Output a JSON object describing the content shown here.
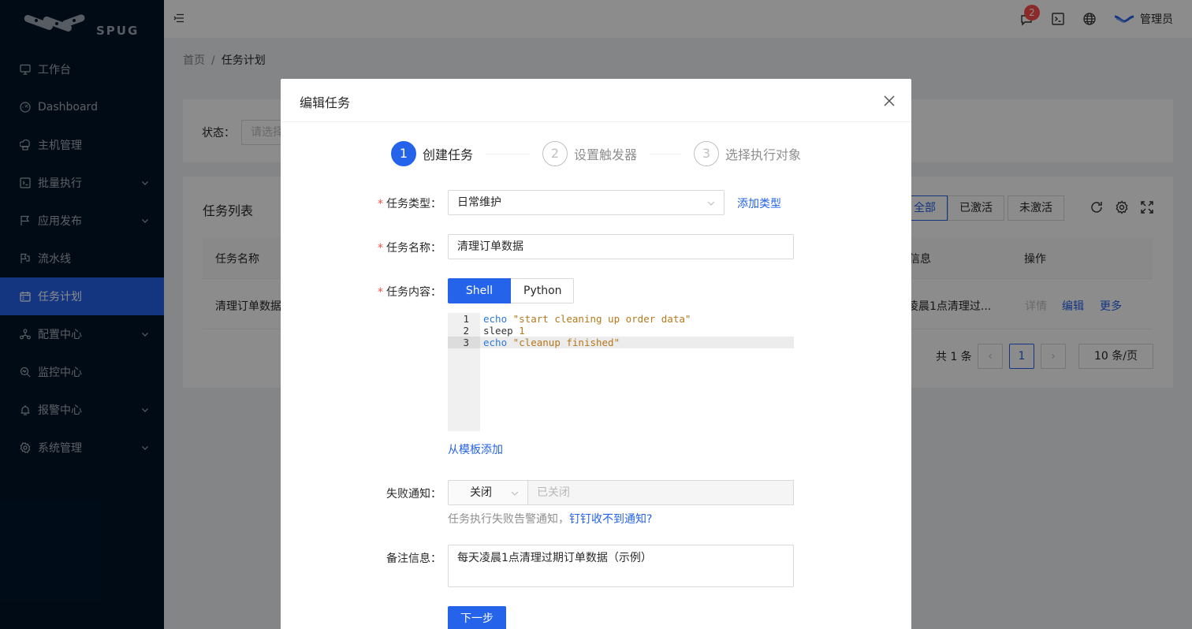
{
  "app": {
    "logo_text": "SPUG",
    "user_name": "管理员",
    "notification_count": "2",
    "accent": "#2563eb"
  },
  "sidebar": {
    "items": [
      {
        "label": "工作台",
        "icon": "desktop-icon"
      },
      {
        "label": "Dashboard",
        "icon": "dashboard-icon"
      },
      {
        "label": "主机管理",
        "icon": "cloud-server-icon"
      },
      {
        "label": "批量执行",
        "icon": "code-icon"
      },
      {
        "label": "应用发布",
        "icon": "flag-icon"
      },
      {
        "label": "流水线",
        "icon": "pipeline-icon"
      },
      {
        "label": "任务计划",
        "icon": "schedule-icon"
      },
      {
        "label": "配置中心",
        "icon": "deployment-icon"
      },
      {
        "label": "监控中心",
        "icon": "monitor-icon"
      },
      {
        "label": "报警中心",
        "icon": "alert-icon"
      },
      {
        "label": "系统管理",
        "icon": "setting-icon"
      }
    ]
  },
  "breadcrumb": {
    "home": "首页",
    "separator": "/",
    "current": "任务计划"
  },
  "filter": {
    "status_label": "状态：",
    "status_placeholder": "请选择"
  },
  "task_list": {
    "title": "任务列表",
    "tabs": [
      "全部",
      "已激活",
      "未激活"
    ],
    "columns": {
      "name": "任务名称",
      "info": "信息",
      "ops": "操作"
    },
    "row": {
      "name": "清理订单数据",
      "info": "凌晨1点清理过...",
      "detail": "详情",
      "edit": "编辑",
      "more": "更多"
    },
    "pagination": {
      "total": "共 1 条",
      "page": "1",
      "page_size": "10 条/页"
    }
  },
  "modal": {
    "title": "编辑任务",
    "steps": [
      {
        "num": "1",
        "title": "创建任务"
      },
      {
        "num": "2",
        "title": "设置触发器"
      },
      {
        "num": "3",
        "title": "选择执行对象"
      }
    ],
    "form": {
      "type_label": "任务类型",
      "type_value": "日常维护",
      "add_type": "添加类型",
      "name_label": "任务名称",
      "name_value": "清理订单数据",
      "content_label": "任务内容",
      "lang_options": [
        "Shell",
        "Python"
      ],
      "code_lines": [
        {
          "num": "1",
          "keyword": "echo",
          "rest": " \"start cleaning up order data\""
        },
        {
          "num": "2",
          "keyword": "sleep",
          "rest": " 1"
        },
        {
          "num": "3",
          "keyword": "echo",
          "rest": " \"cleanup finished\""
        }
      ],
      "from_template": "从模板添加",
      "notify_label": "失败通知",
      "notify_value": "关闭",
      "notify_disabled_placeholder": "已关闭",
      "notify_hint": "任务执行失败告警通知，",
      "notify_link": "钉钉收不到通知?",
      "desc_label": "备注信息",
      "desc_value": "每天凌晨1点清理过期订单数据（示例）",
      "next_button": "下一步",
      "colon": "："
    }
  }
}
